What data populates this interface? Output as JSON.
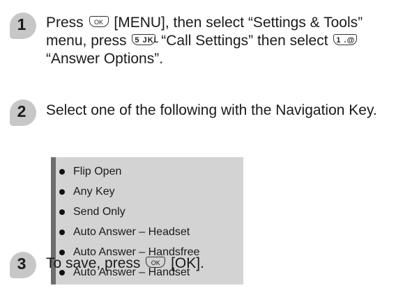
{
  "steps": [
    {
      "number": "1",
      "line1": {
        "a": "Press",
        "key": "OK",
        "b": "[MENU], then select “Settings & Tools”"
      },
      "line2": {
        "a": "menu, press",
        "key": "5 JKL",
        "b": "“Call Settings” then select",
        "key2": "1 .@"
      },
      "line3": "“Answer Options”."
    },
    {
      "number": "2",
      "text": "Select one of the following with the Navigation Key."
    },
    {
      "number": "3",
      "a": "To save, press",
      "key": "OK",
      "b": "[OK]."
    }
  ],
  "options": [
    "Flip Open",
    "Any Key",
    "Send Only",
    "Auto Answer – Headset",
    "Auto Answer – Handsfree",
    "Auto Answer – Handset"
  ]
}
